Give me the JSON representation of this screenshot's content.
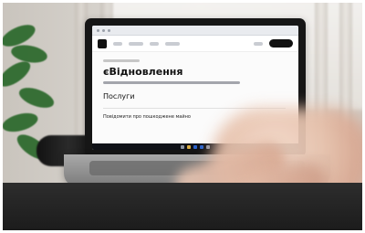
{
  "screen": {
    "page_title": "єВідновлення",
    "section_title": "Послуги",
    "first_item": "Повідомити про пошкоджене майно"
  },
  "colors": {
    "photo_frame": "#ffffff",
    "site_text": "#111111",
    "taskbar_accent": "#2d6cdf"
  },
  "icons": {
    "browser_dot": "browser-window-dot",
    "site_logo": "site-logo",
    "taskbar_icon": "taskbar-app-icon"
  }
}
